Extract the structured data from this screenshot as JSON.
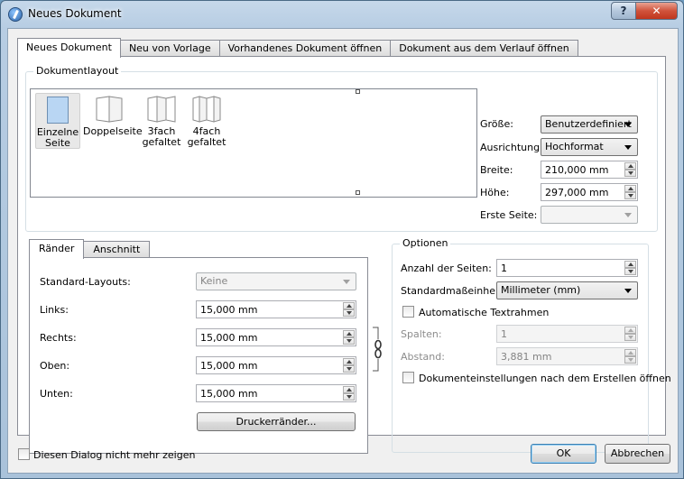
{
  "window": {
    "title": "Neues Dokument",
    "help_label": "?",
    "close_label": "✕"
  },
  "tabs": [
    {
      "label": "Neues Dokument",
      "active": true
    },
    {
      "label": "Neu von Vorlage",
      "active": false
    },
    {
      "label": "Vorhandenes Dokument öffnen",
      "active": false
    },
    {
      "label": "Dokument aus dem Verlauf öffnen",
      "active": false
    }
  ],
  "layout": {
    "legend": "Dokumentlayout",
    "items": [
      {
        "line1": "Einzelne",
        "line2": "Seite",
        "selected": true
      },
      {
        "line1": "Doppelseite",
        "line2": "",
        "selected": false
      },
      {
        "line1": "3fach",
        "line2": "gefaltet",
        "selected": false
      },
      {
        "line1": "4fach",
        "line2": "gefaltet",
        "selected": false
      }
    ]
  },
  "page": {
    "size_label": "Größe:",
    "size_value": "Benutzerdefiniert",
    "orientation_label": "Ausrichtung:",
    "orientation_value": "Hochformat",
    "width_label": "Breite:",
    "width_value": "210,000 mm",
    "height_label": "Höhe:",
    "height_value": "297,000 mm",
    "first_page_label": "Erste Seite:",
    "first_page_value": ""
  },
  "margins": {
    "tabs": [
      "Ränder",
      "Anschnitt"
    ],
    "presets_label": "Standard-Layouts:",
    "presets_value": "Keine",
    "left_label": "Links:",
    "left_value": "15,000 mm",
    "right_label": "Rechts:",
    "right_value": "15,000 mm",
    "top_label": "Oben:",
    "top_value": "15,000 mm",
    "bottom_label": "Unten:",
    "bottom_value": "15,000 mm",
    "printer_button": "Druckerränder..."
  },
  "options": {
    "legend": "Optionen",
    "pages_label": "Anzahl der Seiten:",
    "pages_value": "1",
    "unit_label": "Standardmaßeinheit:",
    "unit_value": "Millimeter (mm)",
    "autoframes_label": "Automatische Textrahmen",
    "columns_label": "Spalten:",
    "columns_value": "1",
    "gap_label": "Abstand:",
    "gap_value": "3,881 mm",
    "open_settings_label": "Dokumenteinstellungen nach dem Erstellen öffnen"
  },
  "footer": {
    "dont_show_label": "Diesen Dialog nicht mehr zeigen",
    "ok_label": "OK",
    "cancel_label": "Abbrechen"
  }
}
